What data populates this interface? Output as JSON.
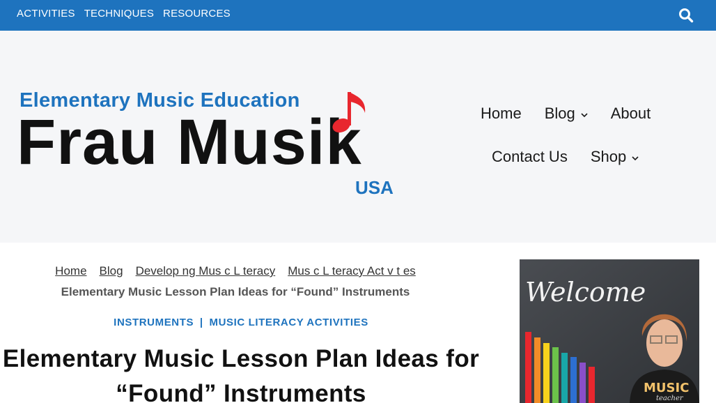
{
  "topbar": {
    "nav": [
      "ACTIVITIES",
      "TECHNIQUES",
      "RESOURCES"
    ],
    "search_icon": "search-icon",
    "color": "#1e73be"
  },
  "logo": {
    "subtitle": "Elementary Music Education",
    "name": "Frau Musik",
    "country": "USA",
    "icon": "music-note-icon"
  },
  "main_nav": {
    "items": [
      {
        "label": "Home",
        "has_dropdown": false
      },
      {
        "label": "Blog",
        "has_dropdown": true
      },
      {
        "label": "About",
        "has_dropdown": false
      },
      {
        "label": "Contact Us",
        "has_dropdown": false
      },
      {
        "label": "Shop",
        "has_dropdown": true
      }
    ]
  },
  "breadcrumb": {
    "links": [
      "Home",
      "Blog",
      "Develop ng Mus c L teracy",
      "Mus c L teracy Act v t es"
    ],
    "current": "Elementary Music Lesson Plan Ideas for “Found” Instruments"
  },
  "post": {
    "categories": [
      "INSTRUMENTS",
      "MUSIC LITERACY ACTIVITIES"
    ],
    "category_separator": "|",
    "title": "Elementary Music Lesson Plan Ideas for “Found” Instruments"
  },
  "sidebar": {
    "welcome_text": "Welcome",
    "shirt_text": "MUSIC",
    "shirt_subtext": "teacher"
  }
}
